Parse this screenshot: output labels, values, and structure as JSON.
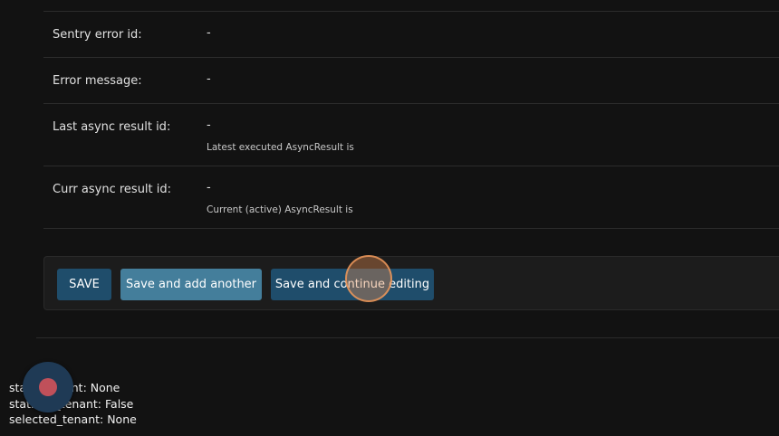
{
  "fields": {
    "sentry_error_id": {
      "label": "Sentry error id:",
      "value": "-"
    },
    "error_message": {
      "label": "Error message:",
      "value": "-"
    },
    "last_async_result_id": {
      "label": "Last async result id:",
      "value": "-",
      "help": "Latest executed AsyncResult is"
    },
    "curr_async_result_id": {
      "label": "Curr async result id:",
      "value": "-",
      "help": "Current (active) AsyncResult is"
    }
  },
  "submit": {
    "save_label": "SAVE",
    "save_add_another_label": "Save and add another",
    "save_continue_label": "Save and continue editing"
  },
  "debug": {
    "line1": "static_tenant: None",
    "line2": "static_is_tenant: False",
    "line3": "selected_tenant: None"
  },
  "colors": {
    "background": "#121212",
    "button_primary": "#1f4d6b",
    "button_secondary": "#447e9b",
    "record_dot": "#c0505a"
  },
  "icons": {
    "record": "record-icon"
  }
}
